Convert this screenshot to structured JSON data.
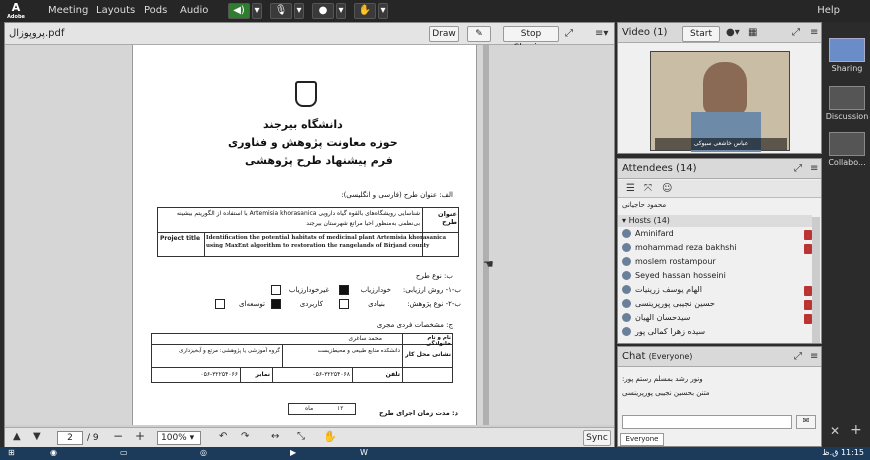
{
  "topbar": {
    "logo": "Adobe",
    "menus": [
      "Meeting",
      "Layouts",
      "Pods",
      "Audio"
    ],
    "help": "Help"
  },
  "share_pod": {
    "filename": "پروپوزال.pdf",
    "draw": "Draw",
    "stop": "Stop Sharing",
    "page_current": "2",
    "page_total": "/ 9",
    "zoom": "100%",
    "sync": "Sync"
  },
  "document": {
    "uni": "دانشگاه بیرجند",
    "dept": "حوزه معاونت پژوهش و فناوری",
    "form": "فرم پیشنهاد طرح پژوهشی",
    "sec_a": "الف: عنوان طرح (فارسی و انگلیسی):",
    "title_label_fa": "عنوان طرح",
    "title_fa": "شناسایی رویشگاه‌های بالقوه گیاه دارویی Artemisia khorasanica با استفاده از الگوریتم بیشینه بی‌نظمی به‌منظور احیا مراتع شهرستان بیرجند",
    "title_label_en": "Project title",
    "title_en": "Identification the potential habitats of medicinal plant Artemisia khorasanica using MaxEnt algorithm to restoration the rangelands of Birjand county",
    "sec_b": "ب: نوع طرح",
    "b1": "ب-۱- روش ارزیابی:",
    "b1_o1": "خودارزیاب",
    "b1_o2": "غیرخودارزیاب",
    "b2": "ب-۲- نوع پژوهش:",
    "b2_o1": "بنیادی",
    "b2_o2": "کاربردی",
    "b2_o3": "توسعه‌ای",
    "sec_c": "ج: مشخصات فردی مجری",
    "name_label": "نام و نام خانوادگی",
    "name": "محمد ساغری",
    "addr_label": "نشانی محل کار",
    "addr1": "دانشکده منابع طبیعی و محیط‌زیست",
    "addr2": "گروه آموزشی یا پژوهشی: مرتع و آبخیزداری",
    "tel_label": "تلفن",
    "tel": "۰۵۶-۳۲۲۵۴۰۶۸",
    "fax_label": "نمابر",
    "fax": "۰۵۶-۳۲۲۵۴۰۶۶",
    "sec_d": "د: مدت زمان اجرای طرح",
    "duration_num": "۱۲",
    "duration_unit": "ماه"
  },
  "video": {
    "title": "Video",
    "count": "(1)",
    "start": "Start",
    "caption": "عباس خاشعی سیوکی"
  },
  "attendees": {
    "title": "Attendees",
    "count": "(14)",
    "presenter": "محمود حاجیانی",
    "hosts_label": "Hosts",
    "hosts_count": "(14)",
    "list": [
      "Aminifard",
      "mohammad reza bakhshi",
      "moslem rostampour",
      "Seyed hassan hosseini",
      "الهام یوسف زرینیات",
      "حسین نجیبی پورپرینسی",
      "سیدحسان الهیان",
      "سیده زهرا کمالی پور"
    ]
  },
  "chat": {
    "title": "Chat",
    "scope": "(Everyone)",
    "lines": [
      "ونور رشد بمسلم رستم پور:",
      "متنن بحسین نجیبی پورپرینسی"
    ],
    "tab": "Everyone"
  },
  "right_tabs": [
    "Sharing",
    "Discussion",
    "Collabo..."
  ],
  "taskbar": {
    "time": "11:15 ق.ظ"
  }
}
